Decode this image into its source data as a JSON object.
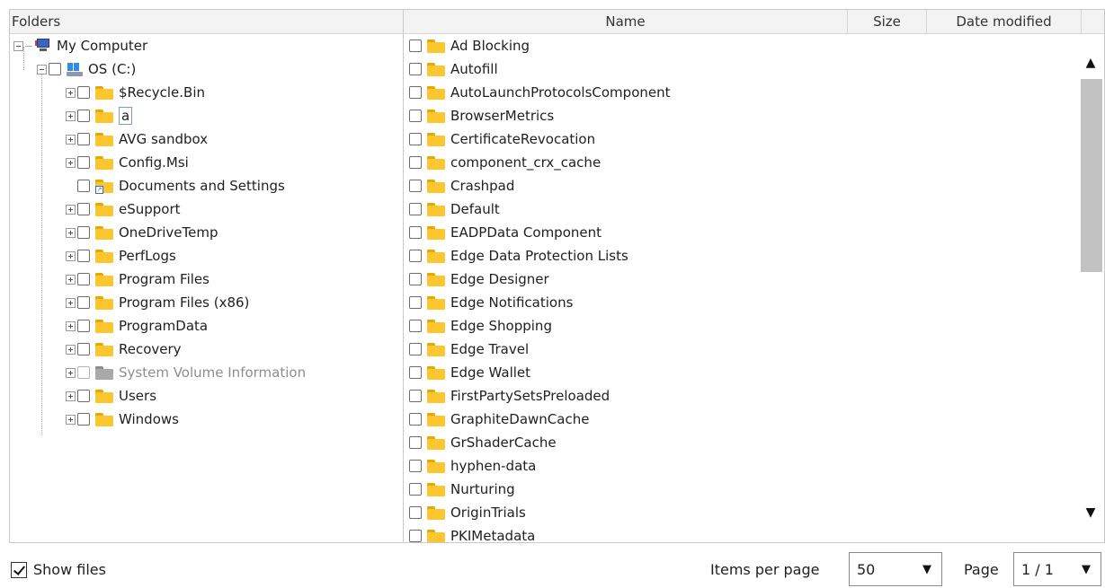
{
  "folders_pane": {
    "header": "Folders",
    "root": {
      "label": "My Computer",
      "icon": "computer-icon"
    },
    "drive": {
      "label": "OS (C:)",
      "icon": "drive-icon"
    },
    "items": [
      {
        "label": "$Recycle.Bin",
        "icon": "folder-icon"
      },
      {
        "label": "a",
        "icon": "folder-icon"
      },
      {
        "label": "AVG sandbox",
        "icon": "folder-icon"
      },
      {
        "label": "Config.Msi",
        "icon": "folder-icon"
      },
      {
        "label": "Documents and Settings",
        "icon": "folder-shortcut-icon"
      },
      {
        "label": "eSupport",
        "icon": "folder-icon"
      },
      {
        "label": "OneDriveTemp",
        "icon": "folder-icon"
      },
      {
        "label": "PerfLogs",
        "icon": "folder-icon"
      },
      {
        "label": "Program Files",
        "icon": "folder-icon"
      },
      {
        "label": "Program Files (x86)",
        "icon": "folder-icon"
      },
      {
        "label": "ProgramData",
        "icon": "folder-icon"
      },
      {
        "label": "Recovery",
        "icon": "folder-icon"
      },
      {
        "label": "System Volume Information",
        "icon": "folder-gray-icon"
      },
      {
        "label": "Users",
        "icon": "folder-icon"
      },
      {
        "label": "Windows",
        "icon": "folder-icon"
      }
    ]
  },
  "files_pane": {
    "columns": {
      "name": "Name",
      "size": "Size",
      "date": "Date modified"
    },
    "rows": [
      "Ad Blocking",
      "Autofill",
      "AutoLaunchProtocolsComponent",
      "BrowserMetrics",
      "CertificateRevocation",
      "component_crx_cache",
      "Crashpad",
      "Default",
      "EADPData Component",
      "Edge Data Protection Lists",
      "Edge Designer",
      "Edge Notifications",
      "Edge Shopping",
      "Edge Travel",
      "Edge Wallet",
      "FirstPartySetsPreloaded",
      "GraphiteDawnCache",
      "GrShaderCache",
      "hyphen-data",
      "Nurturing",
      "OriginTrials",
      "PKIMetadata"
    ]
  },
  "footer": {
    "show_files_label": "Show files",
    "show_files_checked": true,
    "items_per_page_label": "Items per page",
    "items_per_page_value": "50",
    "page_label": "Page",
    "page_value": "1 / 1"
  },
  "colors": {
    "folder": "#fcc72e",
    "folder_tab": "#e8a800",
    "border": "#c9c9c9",
    "header_bg": "#f3f3f3",
    "scroll_thumb": "#c2c2c2"
  }
}
